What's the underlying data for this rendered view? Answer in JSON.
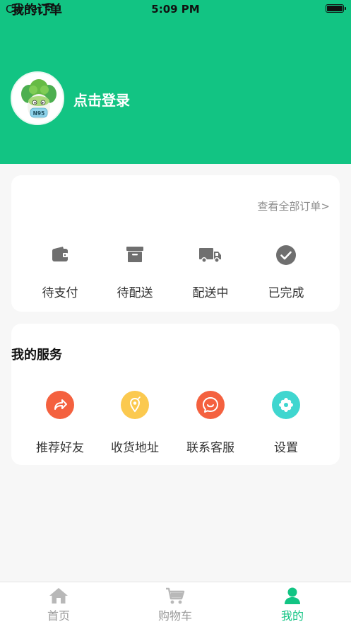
{
  "status_bar": {
    "carrier": "Carrier",
    "time": "5:09 PM"
  },
  "profile": {
    "avatar_badge": "N95",
    "login_label": "点击登录"
  },
  "orders": {
    "title": "我的订单",
    "view_all": "查看全部订单>",
    "items": [
      {
        "label": "待支付",
        "icon": "wallet-icon"
      },
      {
        "label": "待配送",
        "icon": "archive-box-icon"
      },
      {
        "label": "配送中",
        "icon": "truck-icon"
      },
      {
        "label": "已完成",
        "icon": "check-circle-icon"
      }
    ]
  },
  "services": {
    "title": "我的服务",
    "items": [
      {
        "label": "推荐好友",
        "icon": "share-arrow-icon",
        "color": "#f4613f"
      },
      {
        "label": "收货地址",
        "icon": "location-pin-icon",
        "color": "#fbc94f"
      },
      {
        "label": "联系客服",
        "icon": "chat-smile-icon",
        "color": "#f4613f"
      },
      {
        "label": "设置",
        "icon": "settings-flower-icon",
        "color": "#3fd6cf"
      }
    ]
  },
  "tabbar": {
    "tabs": [
      {
        "label": "首页",
        "icon": "home-icon",
        "active": false
      },
      {
        "label": "购物车",
        "icon": "cart-icon",
        "active": false
      },
      {
        "label": "我的",
        "icon": "person-icon",
        "active": true
      }
    ]
  },
  "colors": {
    "brand": "#12c483",
    "inactive": "#9a9a9a",
    "icon_gray": "#6f6f6f"
  }
}
